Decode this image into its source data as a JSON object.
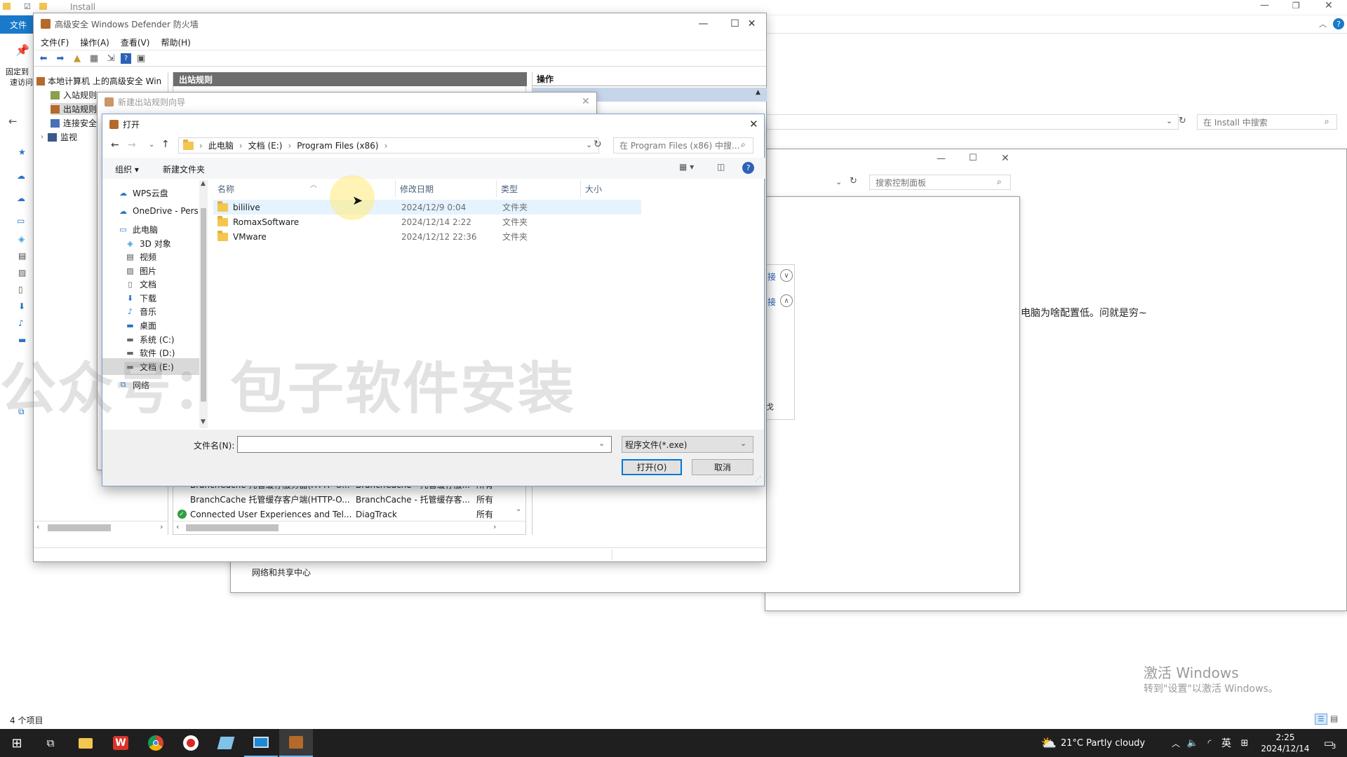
{
  "explorer_bg": {
    "title": "Install",
    "file_tab": "文件",
    "pin_label": "固定到",
    "pin_label2": "速访问",
    "search_placeholder": "在 Install 中搜索",
    "item_count": "4 个项目"
  },
  "control_panel": {
    "search_placeholder": "搜索控制面板",
    "text_snippet": "电脑为啥配置低。问就是穷~",
    "footer_link": "网络和共享中心",
    "chevron_label_1": "接",
    "chevron_label_2": "接",
    "side_char": "戈"
  },
  "firewall": {
    "title": "高级安全 Windows Defender 防火墙",
    "menus": [
      "文件(F)",
      "操作(A)",
      "查看(V)",
      "帮助(H)"
    ],
    "tree": [
      "本地计算机 上的高级安全 Win",
      "入站规则",
      "出站规则",
      "连接安全",
      "监视"
    ],
    "center_header": "出站规则",
    "right_header": "操作",
    "rules": [
      {
        "name": "BranchCache 托管缓存服务器(HTTP-O...",
        "group": "BranchCache - 托管缓存服...",
        "profile": "所有",
        "enabled": false
      },
      {
        "name": "BranchCache 托管缓存客户端(HTTP-O...",
        "group": "BranchCache - 托管缓存客...",
        "profile": "所有",
        "enabled": false
      },
      {
        "name": "Connected User Experiences and Tel...",
        "group": "DiagTrack",
        "profile": "所有",
        "enabled": true
      }
    ]
  },
  "wizard": {
    "title": "新建出站规则向导"
  },
  "open_dialog": {
    "title": "打开",
    "breadcrumb": [
      "此电脑",
      "文档 (E:)",
      "Program Files (x86)"
    ],
    "search_placeholder": "在 Program Files (x86) 中搜...",
    "organize_label": "组织 ▾",
    "new_folder_label": "新建文件夹",
    "columns": {
      "name": "名称",
      "date": "修改日期",
      "type": "类型",
      "size": "大小"
    },
    "files": [
      {
        "name": "bililive",
        "date": "2024/12/9 0:04",
        "type": "文件夹"
      },
      {
        "name": "RomaxSoftware",
        "date": "2024/12/14 2:22",
        "type": "文件夹"
      },
      {
        "name": "VMware",
        "date": "2024/12/12 22:36",
        "type": "文件夹"
      }
    ],
    "nav": [
      {
        "label": "WPS云盘",
        "icon": "cloud-icon",
        "indent": 1
      },
      {
        "label": "OneDrive - Pers",
        "icon": "onedrive-icon",
        "indent": 1
      },
      {
        "label": "此电脑",
        "icon": "computer-icon",
        "indent": 1
      },
      {
        "label": "3D 对象",
        "icon": "cube-icon",
        "indent": 2
      },
      {
        "label": "视频",
        "icon": "video-icon",
        "indent": 2
      },
      {
        "label": "图片",
        "icon": "picture-icon",
        "indent": 2
      },
      {
        "label": "文档",
        "icon": "document-icon",
        "indent": 2
      },
      {
        "label": "下载",
        "icon": "download-icon",
        "indent": 2
      },
      {
        "label": "音乐",
        "icon": "music-icon",
        "indent": 2
      },
      {
        "label": "桌面",
        "icon": "desktop-icon",
        "indent": 2
      },
      {
        "label": "系统 (C:)",
        "icon": "drive-icon",
        "indent": 2
      },
      {
        "label": "软件 (D:)",
        "icon": "drive-icon",
        "indent": 2
      },
      {
        "label": "文档 (E:)",
        "icon": "drive-icon",
        "indent": 2
      },
      {
        "label": "网络",
        "icon": "network-icon",
        "indent": 1
      }
    ],
    "filename_label": "文件名(N):",
    "filename_value": "",
    "filetype_value": "程序文件(*.exe)",
    "open_button": "打开(O)",
    "cancel_button": "取消"
  },
  "watermark": "公众号：包子软件安装",
  "activation": {
    "line1": "激活 Windows",
    "line2": "转到\"设置\"以激活 Windows。"
  },
  "taskbar": {
    "weather": "21°C  Partly cloudy",
    "time": "2:25",
    "date": "2024/12/14",
    "ime": "英",
    "notification_count": "3"
  },
  "colors": {
    "accent": "#0078d7",
    "taskbar": "#1f1f1f",
    "selection": "#cce8ff",
    "header_dark": "#6d6d6d"
  }
}
